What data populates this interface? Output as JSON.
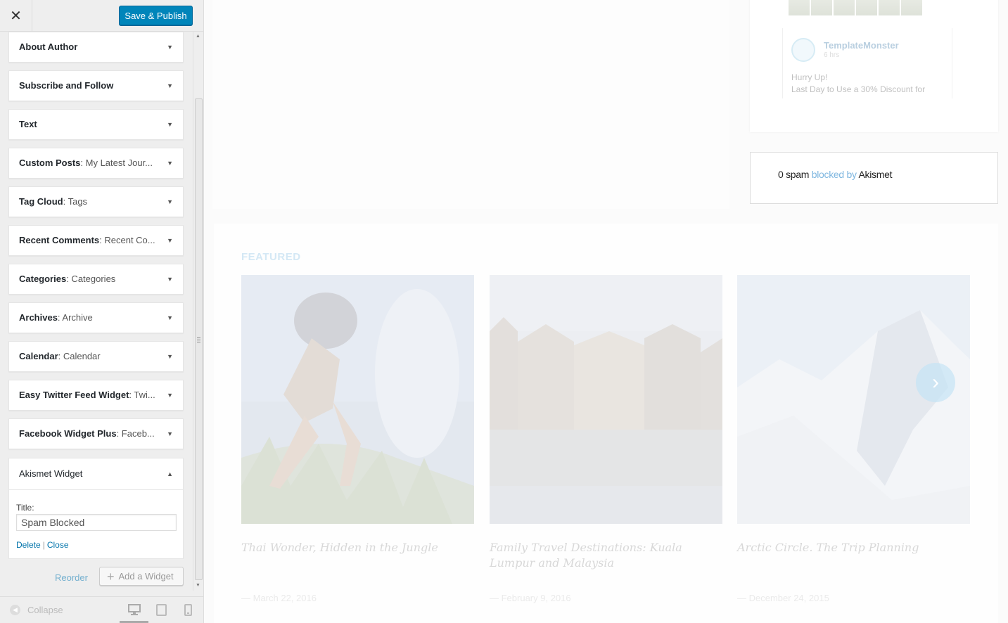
{
  "header": {
    "close_label": "✕",
    "publish_label": "Save & Publish"
  },
  "widgets": [
    {
      "name": "About Author",
      "sub": ""
    },
    {
      "name": "Subscribe and Follow",
      "sub": ""
    },
    {
      "name": "Text",
      "sub": ""
    },
    {
      "name": "Custom Posts",
      "sub": ": My Latest Jour..."
    },
    {
      "name": "Tag Cloud",
      "sub": ": Tags"
    },
    {
      "name": "Recent Comments",
      "sub": ": Recent Co..."
    },
    {
      "name": "Categories",
      "sub": ": Categories"
    },
    {
      "name": "Archives",
      "sub": ": Archive"
    },
    {
      "name": "Calendar",
      "sub": ": Calendar"
    },
    {
      "name": "Easy Twitter Feed Widget",
      "sub": ": Twi..."
    },
    {
      "name": "Facebook Widget Plus",
      "sub": ": Faceb..."
    }
  ],
  "akismet_widget": {
    "name": "Akismet Widget",
    "title_label": "Title:",
    "title_value": "Spam Blocked",
    "delete_label": "Delete",
    "separator": "|",
    "close_label": "Close"
  },
  "actions": {
    "reorder_label": "Reorder",
    "add_widget_label": "Add a Widget"
  },
  "footer": {
    "collapse_label": "Collapse"
  },
  "preview": {
    "fb": {
      "page_name": "TemplateMonster",
      "time": "6 hrs",
      "line1": "Hurry Up!",
      "line2": "Last Day to Use a 30% Discount for"
    },
    "akismet": {
      "count": "0 spam",
      "blocked_by": "blocked by",
      "brand": "Akismet"
    },
    "featured_heading": "FEATURED",
    "posts": [
      {
        "title": "Thai Wonder, Hidden in the Jungle",
        "date": "—  March 22, 2016"
      },
      {
        "title": "Family Travel Destinations: Kuala Lumpur and Malaysia",
        "date": "—  February 9, 2016"
      },
      {
        "title": "Arctic Circle. The Trip Planning",
        "date": "—  December 24, 2015"
      }
    ]
  },
  "icons": {
    "close": "close-icon",
    "expand": "arrow-down-icon",
    "collapse": "arrow-up-icon",
    "plus": "plus-icon",
    "desktop": "desktop-icon",
    "tablet": "tablet-icon",
    "mobile": "mobile-icon"
  },
  "colors": {
    "publish": "#0085ba",
    "link": "#0073aa",
    "muted_link": "#74b0cf",
    "akismet_blue": "#7fb7e0"
  }
}
